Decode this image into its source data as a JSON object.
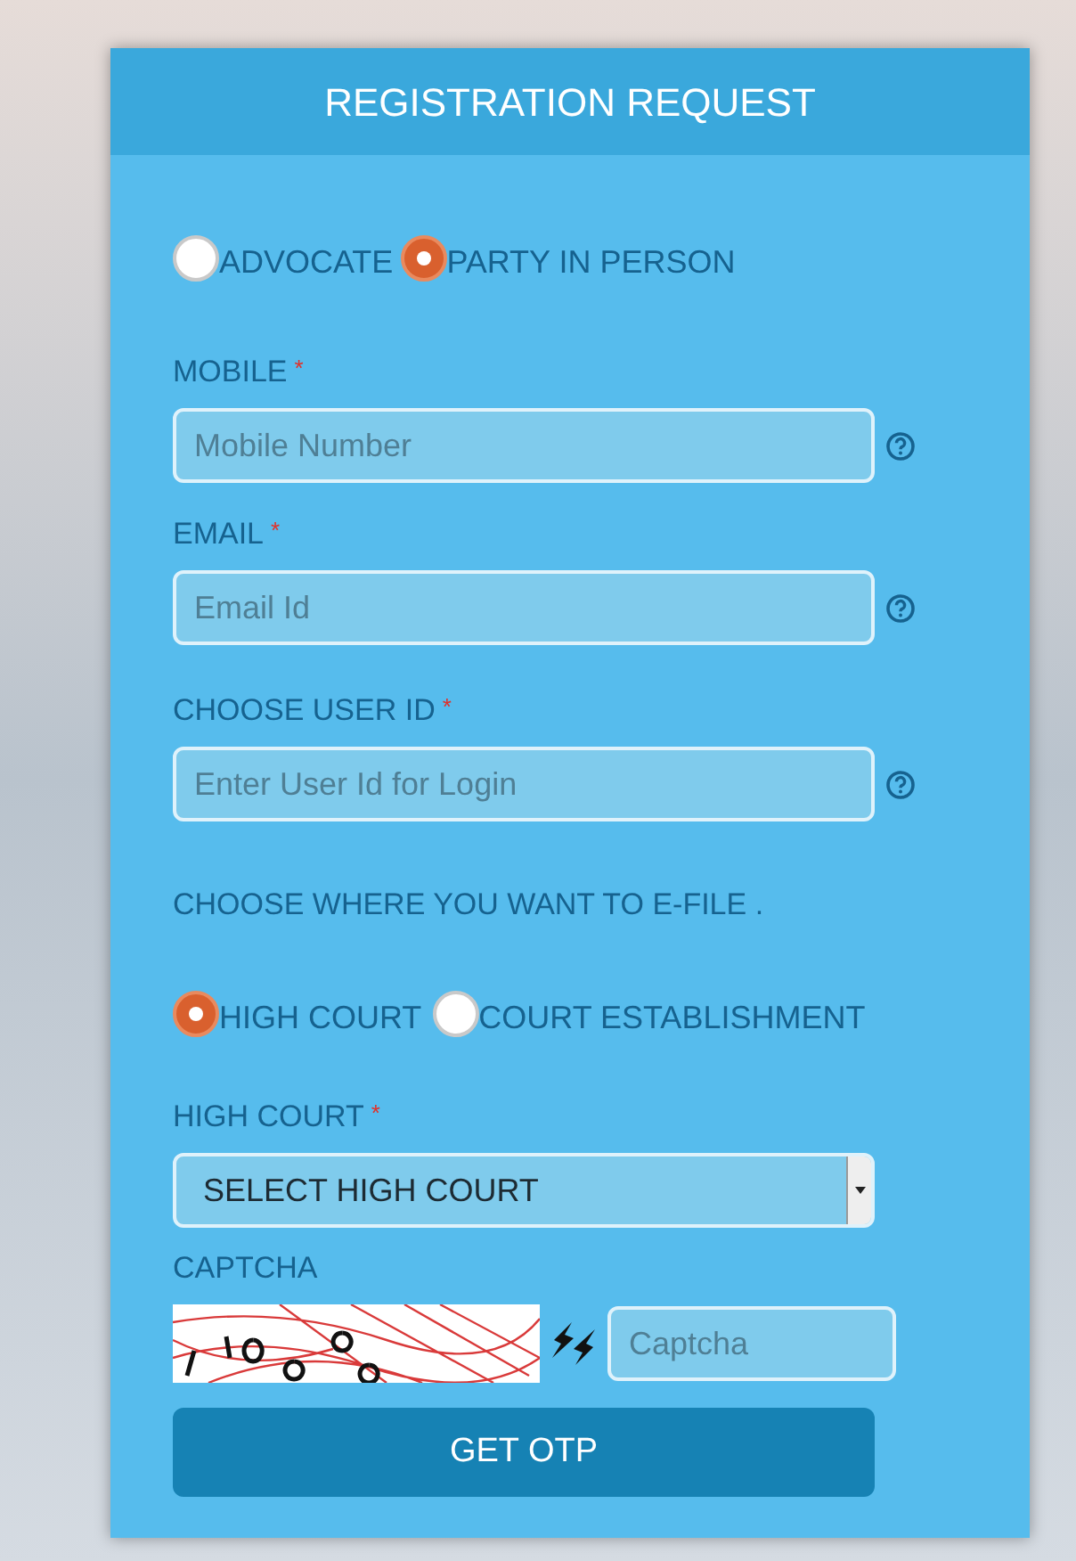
{
  "title": "REGISTRATION REQUEST",
  "user_types": [
    {
      "label": "ADVOCATE",
      "selected": false
    },
    {
      "label": "PARTY IN PERSON",
      "selected": true
    }
  ],
  "fields": [
    {
      "label": "MOBILE",
      "required_mark": "*",
      "placeholder": "Mobile Number"
    },
    {
      "label": "EMAIL",
      "required_mark": "*",
      "placeholder": "Email Id"
    },
    {
      "label": "CHOOSE USER ID",
      "required_mark": "*",
      "placeholder": "Enter User Id for Login"
    }
  ],
  "efile_prompt": "CHOOSE WHERE YOU WANT TO E-FILE .",
  "efile_options": [
    {
      "label": "HIGH COURT",
      "selected": true
    },
    {
      "label": "COURT ESTABLISHMENT",
      "selected": false
    }
  ],
  "court_select": {
    "label": "HIGH COURT",
    "required_mark": "*",
    "value": "SELECT HIGH COURT"
  },
  "captcha": {
    "label": "CAPTCHA",
    "placeholder": "Captcha"
  },
  "submit": "GET OTP"
}
